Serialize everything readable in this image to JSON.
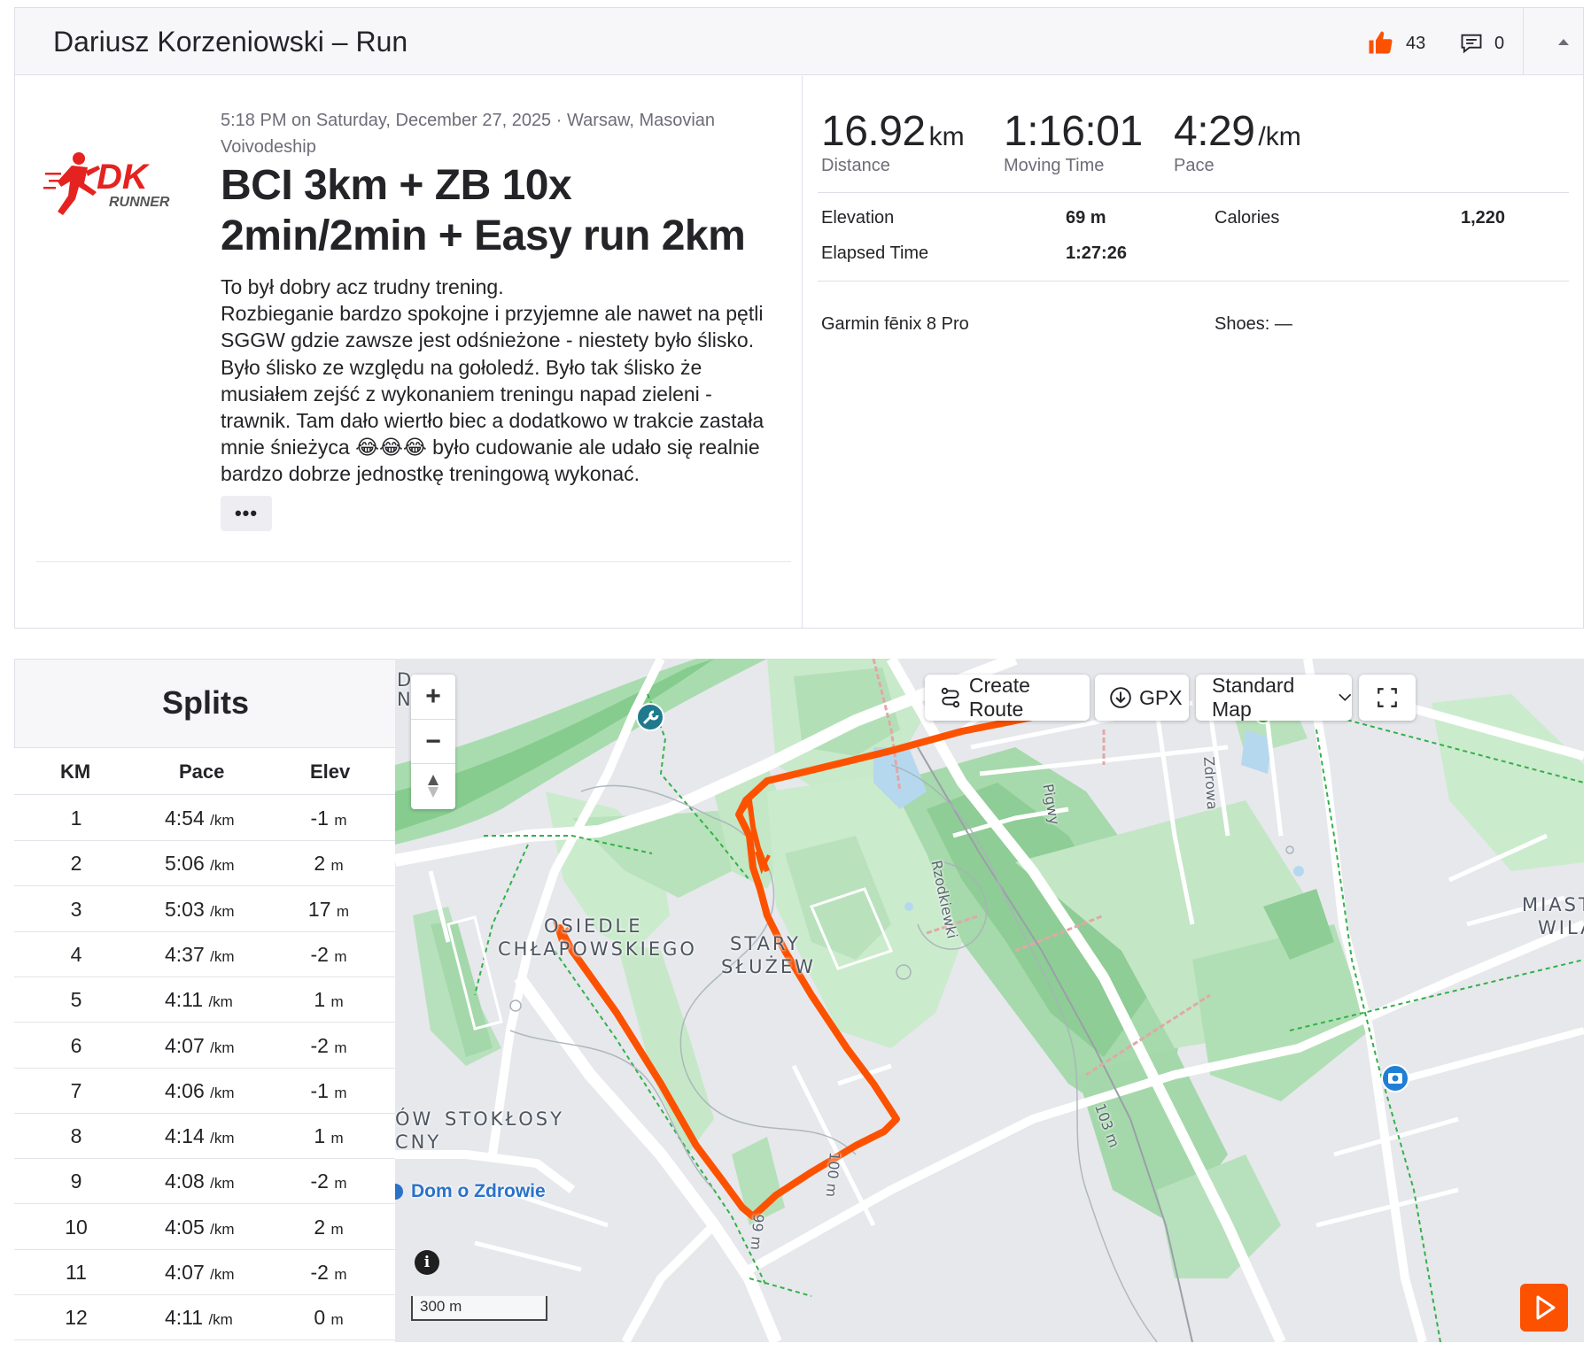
{
  "header": {
    "title": "Dariusz Korzeniowski – Run",
    "kudos_count": "43",
    "comment_count": "0"
  },
  "activity": {
    "meta": "5:18 PM on Saturday, December 27, 2025 · Warsaw, Masovian Voivodeship",
    "title": "BCI 3km + ZB 10x 2min/2min + Easy run 2km",
    "description": "To był dobry acz trudny trening.\nRozbieganie bardzo spokojne i przyjemne ale nawet na pętli SGGW gdzie zawsze jest odśnieżone - niestety było ślisko. Było ślisko ze względu na gołoledź. Było tak ślisko że musiałem zejść z wykonaniem treningu napad zieleni - trawnik. Tam dało wiertło biec a dodatkowo w trakcie zastała mnie śnieżyca 😂😂😂 było cudowanie ale udało się realnie bardzo dobrze jednostkę treningową wykonać.",
    "more_label": "•••",
    "logo_text": "DK",
    "logo_subtext": "RUNNER"
  },
  "stats": {
    "distance": {
      "value": "16.92",
      "unit": "km",
      "label": "Distance"
    },
    "moving_time": {
      "value": "1:16:01",
      "label": "Moving Time"
    },
    "pace": {
      "value": "4:29",
      "unit": "/km",
      "label": "Pace"
    },
    "elevation": {
      "label": "Elevation",
      "value": "69 m"
    },
    "calories": {
      "label": "Calories",
      "value": "1,220"
    },
    "elapsed": {
      "label": "Elapsed Time",
      "value": "1:27:26"
    },
    "device": "Garmin fēnix 8 Pro",
    "shoes": "Shoes: —"
  },
  "splits": {
    "title": "Splits",
    "columns": [
      "KM",
      "Pace",
      "Elev"
    ],
    "pace_unit": "/km",
    "elev_unit": "m",
    "rows": [
      {
        "km": "1",
        "pace": "4:54",
        "elev": "-1"
      },
      {
        "km": "2",
        "pace": "5:06",
        "elev": "2"
      },
      {
        "km": "3",
        "pace": "5:03",
        "elev": "17"
      },
      {
        "km": "4",
        "pace": "4:37",
        "elev": "-2"
      },
      {
        "km": "5",
        "pace": "4:11",
        "elev": "1"
      },
      {
        "km": "6",
        "pace": "4:07",
        "elev": "-2"
      },
      {
        "km": "7",
        "pace": "4:06",
        "elev": "-1"
      },
      {
        "km": "8",
        "pace": "4:14",
        "elev": "1"
      },
      {
        "km": "9",
        "pace": "4:08",
        "elev": "-2"
      },
      {
        "km": "10",
        "pace": "4:05",
        "elev": "2"
      },
      {
        "km": "11",
        "pace": "4:07",
        "elev": "-2"
      },
      {
        "km": "12",
        "pace": "4:11",
        "elev": "0"
      }
    ]
  },
  "map": {
    "zoom_in": "+",
    "zoom_out": "−",
    "compass": "▲",
    "create_route": "Create Route",
    "gpx": "GPX",
    "map_type": "Standard Map",
    "scale": "300 m",
    "info": "i",
    "labels": {
      "osiedle_1": "OSIEDLE",
      "osiedle_2": "CHŁAPOWSKIEGO",
      "stary_1": "STARY",
      "stary_2": "SŁUŻEW",
      "stoklosy": "STOKŁOSY",
      "ow": "ÓW",
      "cny": "CNY",
      "miast": "MIAST",
      "wil": "WILA",
      "d": "D",
      "ni": "NI",
      "rzodkiewki": "Rzodkiewki",
      "pigwy": "Pigwy",
      "zdrowa": "Zdrowa",
      "c103": "103 m",
      "c100": "100 m",
      "c99": "99 m",
      "poi": "Dom o Zdrowie"
    },
    "route_color": "#fc5200"
  }
}
